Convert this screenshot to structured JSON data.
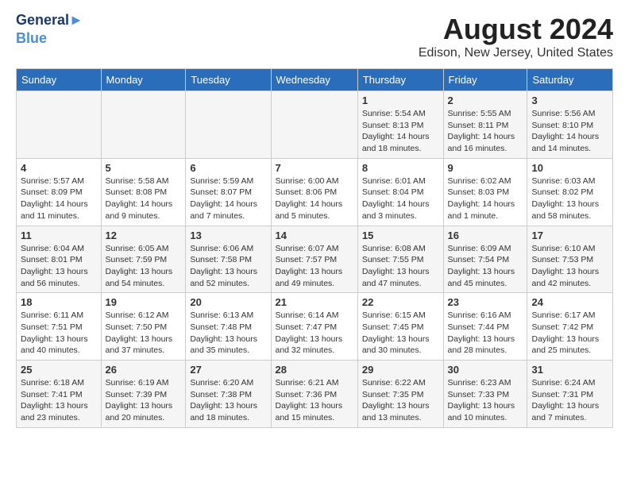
{
  "header": {
    "logo_line1": "General",
    "logo_line2": "Blue",
    "month": "August 2024",
    "location": "Edison, New Jersey, United States"
  },
  "weekdays": [
    "Sunday",
    "Monday",
    "Tuesday",
    "Wednesday",
    "Thursday",
    "Friday",
    "Saturday"
  ],
  "weeks": [
    [
      {
        "day": "",
        "info": ""
      },
      {
        "day": "",
        "info": ""
      },
      {
        "day": "",
        "info": ""
      },
      {
        "day": "",
        "info": ""
      },
      {
        "day": "1",
        "info": "Sunrise: 5:54 AM\nSunset: 8:13 PM\nDaylight: 14 hours\nand 18 minutes."
      },
      {
        "day": "2",
        "info": "Sunrise: 5:55 AM\nSunset: 8:11 PM\nDaylight: 14 hours\nand 16 minutes."
      },
      {
        "day": "3",
        "info": "Sunrise: 5:56 AM\nSunset: 8:10 PM\nDaylight: 14 hours\nand 14 minutes."
      }
    ],
    [
      {
        "day": "4",
        "info": "Sunrise: 5:57 AM\nSunset: 8:09 PM\nDaylight: 14 hours\nand 11 minutes."
      },
      {
        "day": "5",
        "info": "Sunrise: 5:58 AM\nSunset: 8:08 PM\nDaylight: 14 hours\nand 9 minutes."
      },
      {
        "day": "6",
        "info": "Sunrise: 5:59 AM\nSunset: 8:07 PM\nDaylight: 14 hours\nand 7 minutes."
      },
      {
        "day": "7",
        "info": "Sunrise: 6:00 AM\nSunset: 8:06 PM\nDaylight: 14 hours\nand 5 minutes."
      },
      {
        "day": "8",
        "info": "Sunrise: 6:01 AM\nSunset: 8:04 PM\nDaylight: 14 hours\nand 3 minutes."
      },
      {
        "day": "9",
        "info": "Sunrise: 6:02 AM\nSunset: 8:03 PM\nDaylight: 14 hours\nand 1 minute."
      },
      {
        "day": "10",
        "info": "Sunrise: 6:03 AM\nSunset: 8:02 PM\nDaylight: 13 hours\nand 58 minutes."
      }
    ],
    [
      {
        "day": "11",
        "info": "Sunrise: 6:04 AM\nSunset: 8:01 PM\nDaylight: 13 hours\nand 56 minutes."
      },
      {
        "day": "12",
        "info": "Sunrise: 6:05 AM\nSunset: 7:59 PM\nDaylight: 13 hours\nand 54 minutes."
      },
      {
        "day": "13",
        "info": "Sunrise: 6:06 AM\nSunset: 7:58 PM\nDaylight: 13 hours\nand 52 minutes."
      },
      {
        "day": "14",
        "info": "Sunrise: 6:07 AM\nSunset: 7:57 PM\nDaylight: 13 hours\nand 49 minutes."
      },
      {
        "day": "15",
        "info": "Sunrise: 6:08 AM\nSunset: 7:55 PM\nDaylight: 13 hours\nand 47 minutes."
      },
      {
        "day": "16",
        "info": "Sunrise: 6:09 AM\nSunset: 7:54 PM\nDaylight: 13 hours\nand 45 minutes."
      },
      {
        "day": "17",
        "info": "Sunrise: 6:10 AM\nSunset: 7:53 PM\nDaylight: 13 hours\nand 42 minutes."
      }
    ],
    [
      {
        "day": "18",
        "info": "Sunrise: 6:11 AM\nSunset: 7:51 PM\nDaylight: 13 hours\nand 40 minutes."
      },
      {
        "day": "19",
        "info": "Sunrise: 6:12 AM\nSunset: 7:50 PM\nDaylight: 13 hours\nand 37 minutes."
      },
      {
        "day": "20",
        "info": "Sunrise: 6:13 AM\nSunset: 7:48 PM\nDaylight: 13 hours\nand 35 minutes."
      },
      {
        "day": "21",
        "info": "Sunrise: 6:14 AM\nSunset: 7:47 PM\nDaylight: 13 hours\nand 32 minutes."
      },
      {
        "day": "22",
        "info": "Sunrise: 6:15 AM\nSunset: 7:45 PM\nDaylight: 13 hours\nand 30 minutes."
      },
      {
        "day": "23",
        "info": "Sunrise: 6:16 AM\nSunset: 7:44 PM\nDaylight: 13 hours\nand 28 minutes."
      },
      {
        "day": "24",
        "info": "Sunrise: 6:17 AM\nSunset: 7:42 PM\nDaylight: 13 hours\nand 25 minutes."
      }
    ],
    [
      {
        "day": "25",
        "info": "Sunrise: 6:18 AM\nSunset: 7:41 PM\nDaylight: 13 hours\nand 23 minutes."
      },
      {
        "day": "26",
        "info": "Sunrise: 6:19 AM\nSunset: 7:39 PM\nDaylight: 13 hours\nand 20 minutes."
      },
      {
        "day": "27",
        "info": "Sunrise: 6:20 AM\nSunset: 7:38 PM\nDaylight: 13 hours\nand 18 minutes."
      },
      {
        "day": "28",
        "info": "Sunrise: 6:21 AM\nSunset: 7:36 PM\nDaylight: 13 hours\nand 15 minutes."
      },
      {
        "day": "29",
        "info": "Sunrise: 6:22 AM\nSunset: 7:35 PM\nDaylight: 13 hours\nand 13 minutes."
      },
      {
        "day": "30",
        "info": "Sunrise: 6:23 AM\nSunset: 7:33 PM\nDaylight: 13 hours\nand 10 minutes."
      },
      {
        "day": "31",
        "info": "Sunrise: 6:24 AM\nSunset: 7:31 PM\nDaylight: 13 hours\nand 7 minutes."
      }
    ]
  ]
}
